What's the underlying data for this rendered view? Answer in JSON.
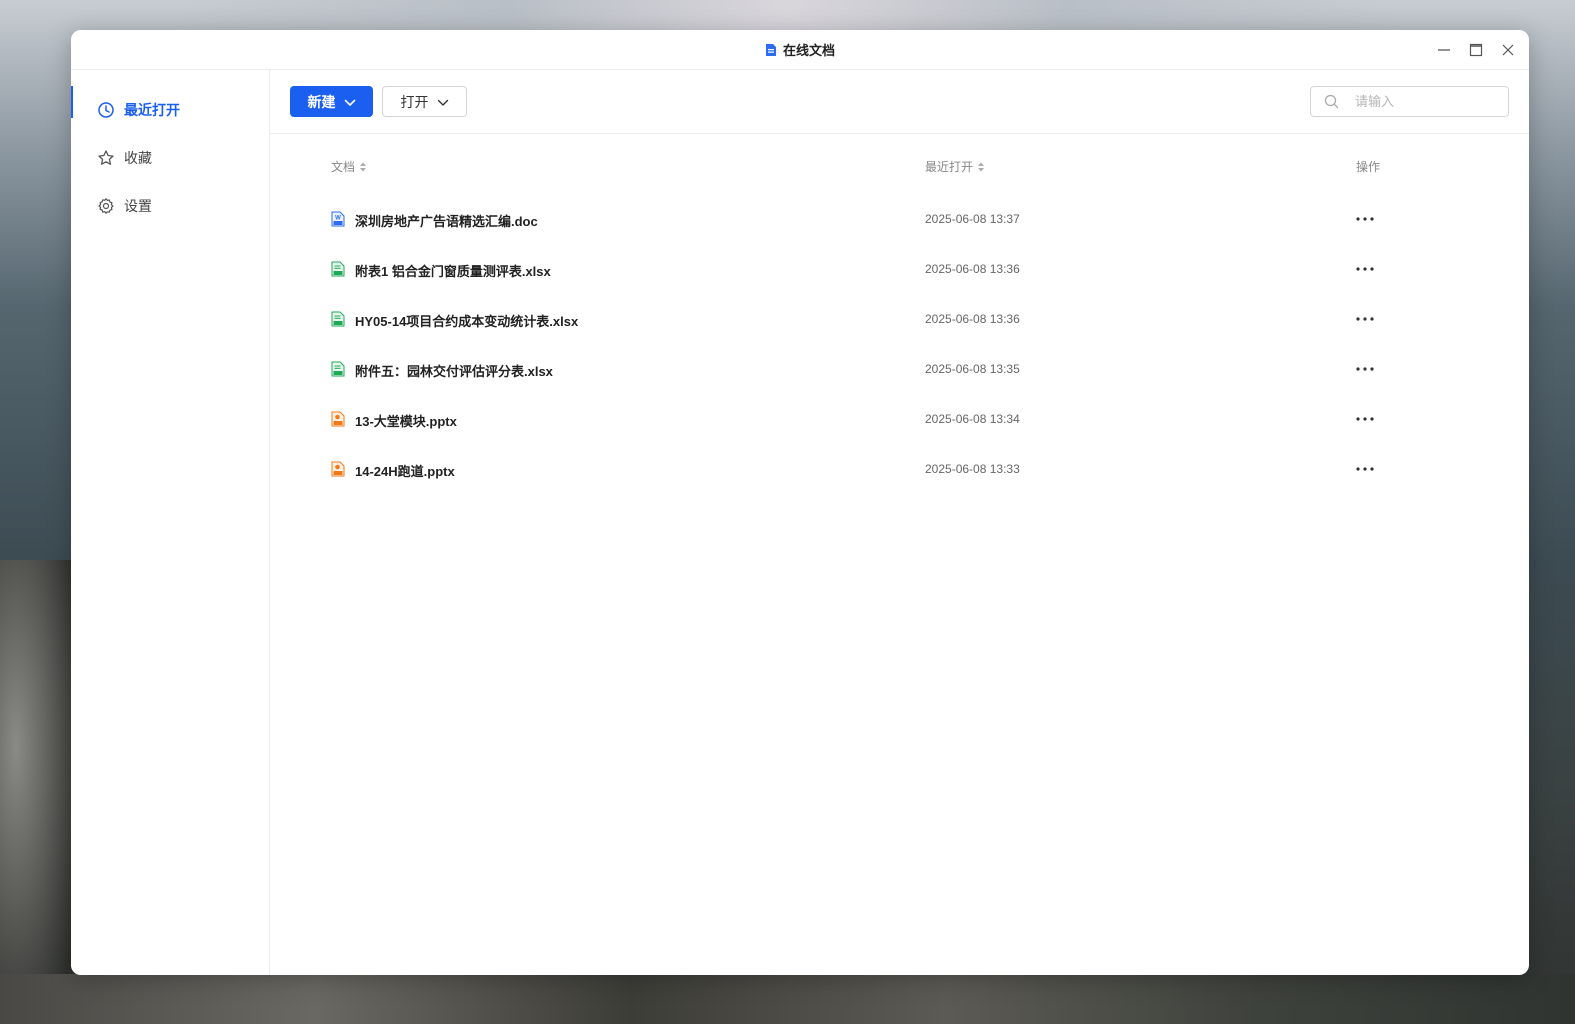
{
  "window": {
    "title": "在线文档"
  },
  "sidebar": {
    "items": [
      {
        "label": "最近打开",
        "icon": "clock-icon",
        "active": true
      },
      {
        "label": "收藏",
        "icon": "star-icon",
        "active": false
      },
      {
        "label": "设置",
        "icon": "gear-icon",
        "active": false
      }
    ]
  },
  "toolbar": {
    "new_label": "新建",
    "open_label": "打开"
  },
  "search": {
    "placeholder": "请输入",
    "value": ""
  },
  "table": {
    "headers": {
      "document": "文档",
      "recent": "最近打开",
      "actions": "操作"
    },
    "rows": [
      {
        "name": "深圳房地产广告语精选汇编.doc",
        "time": "2025-06-08 13:37",
        "type": "doc"
      },
      {
        "name": "附表1 铝合金门窗质量测评表.xlsx",
        "time": "2025-06-08 13:36",
        "type": "xlsx"
      },
      {
        "name": "HY05-14项目合约成本变动统计表.xlsx",
        "time": "2025-06-08 13:36",
        "type": "xlsx"
      },
      {
        "name": "附件五：园林交付评估评分表.xlsx",
        "time": "2025-06-08 13:35",
        "type": "xlsx"
      },
      {
        "name": "13-大堂模块.pptx",
        "time": "2025-06-08 13:34",
        "type": "pptx"
      },
      {
        "name": "14-24H跑道.pptx",
        "time": "2025-06-08 13:33",
        "type": "pptx"
      }
    ]
  },
  "colors": {
    "accent": "#1a5ff0",
    "doc": "#2d6bf0",
    "xlsx": "#1fa855",
    "pptx": "#f07a1a"
  }
}
